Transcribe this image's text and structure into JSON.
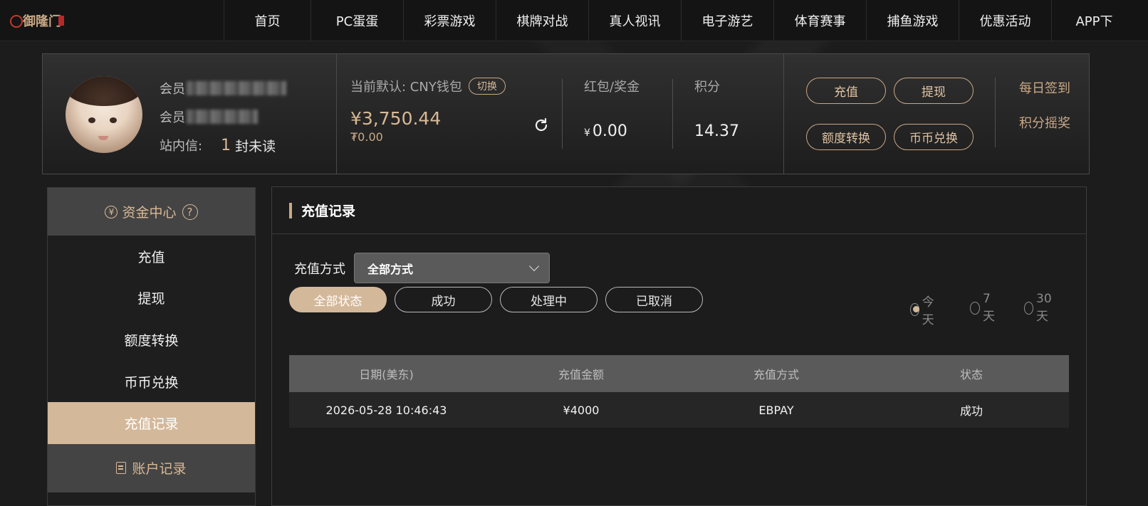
{
  "brand": {
    "logo_text": "御隆门"
  },
  "nav": {
    "items": [
      {
        "label": "首页",
        "width": 122
      },
      {
        "label": "PC蛋蛋",
        "width": 130
      },
      {
        "label": "彩票游戏",
        "width": 130
      },
      {
        "label": "棋牌对战",
        "width": 130
      },
      {
        "label": "真人视讯",
        "width": 130
      },
      {
        "label": "电子游艺",
        "width": 130
      },
      {
        "label": "体育赛事",
        "width": 130
      },
      {
        "label": "捕鱼游戏",
        "width": 130
      },
      {
        "label": "优惠活动",
        "width": 130
      },
      {
        "label": "APP下",
        "width": 120
      }
    ]
  },
  "member": {
    "account_label": "会员",
    "name_label": "会员",
    "inbox_label": "站内信:",
    "unread_count": "1",
    "unread_text": "封未读"
  },
  "wallet": {
    "label": "当前默认: CNY钱包",
    "switch_label": "切换",
    "balance": "¥3,750.44",
    "sub_balance": "₮0.00"
  },
  "bonus": {
    "label": "红包/奖金",
    "currency": "¥",
    "value": "0.00"
  },
  "points": {
    "label": "积分",
    "value": "14.37"
  },
  "actions": {
    "deposit": "充值",
    "withdraw": "提现",
    "transfer": "额度转换",
    "exchange": "币币兑换",
    "daily_checkin": "每日签到",
    "points_lottery": "积分摇奖"
  },
  "sidebar": {
    "header": "资金中心",
    "items": [
      {
        "label": "充值",
        "active": false
      },
      {
        "label": "提现",
        "active": false
      },
      {
        "label": "额度转换",
        "active": false
      },
      {
        "label": "币币兑换",
        "active": false
      },
      {
        "label": "充值记录",
        "active": true
      }
    ],
    "footer": "账户记录"
  },
  "main": {
    "title": "充值记录",
    "filter_label": "充值方式",
    "filter_value": "全部方式",
    "status_buttons": [
      "全部状态",
      "成功",
      "处理中",
      "已取消"
    ],
    "ranges": [
      "今天",
      "7天",
      "30天"
    ],
    "table": {
      "headers": [
        "日期(美东)",
        "充值金额",
        "充值方式",
        "状态"
      ],
      "rows": [
        [
          "2026-05-28 10:46:43",
          "¥4000",
          "EBPAY",
          "成功"
        ]
      ]
    }
  },
  "colors": {
    "accent": "#d4b89a",
    "accent_text": "#d9b995",
    "background": "#1c1c1c"
  }
}
